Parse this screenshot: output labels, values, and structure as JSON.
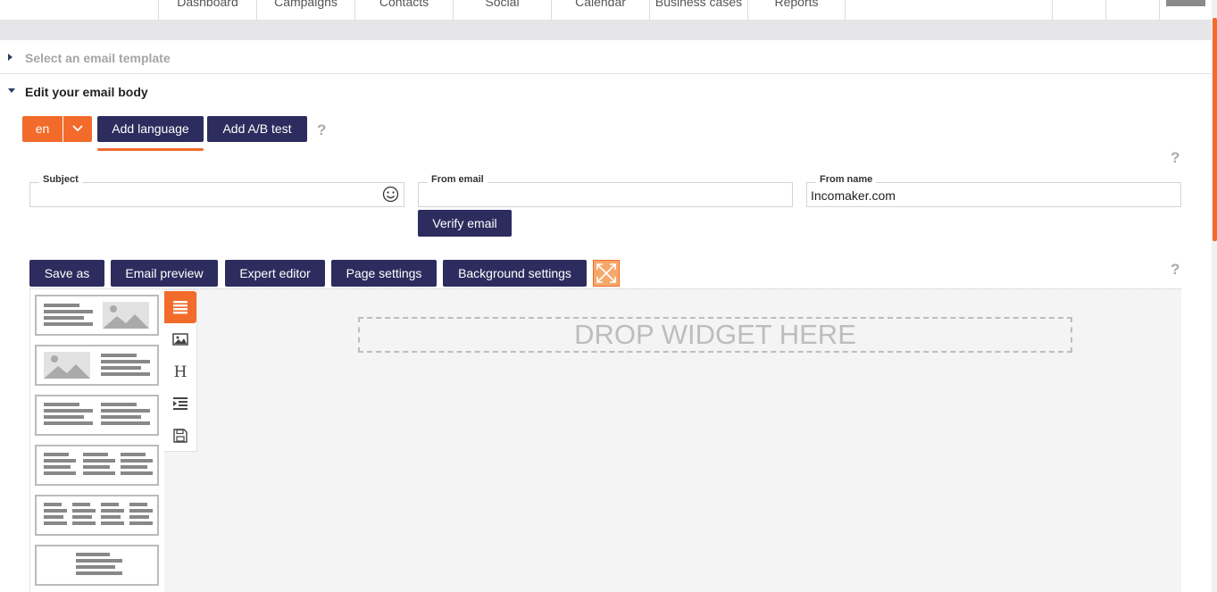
{
  "nav": {
    "tabs": [
      "Dashboard",
      "Campaigns",
      "Contacts",
      "Social",
      "Calendar",
      "Business cases",
      "Reports"
    ]
  },
  "sections": {
    "template_label": "Select an email template",
    "body_label": "Edit your email body"
  },
  "language": {
    "selected": "en",
    "add_language_label": "Add language",
    "add_ab_label": "Add A/B test",
    "help": "?"
  },
  "form": {
    "subject_label": "Subject",
    "subject_value": "",
    "from_email_label": "From email",
    "from_email_value": "",
    "from_name_label": "From name",
    "from_name_value": "Incomaker.com",
    "verify_label": "Verify email",
    "help": "?"
  },
  "toolbar": {
    "save_as": "Save as",
    "email_preview": "Email preview",
    "expert_editor": "Expert editor",
    "page_settings": "Page settings",
    "background_settings": "Background settings",
    "help": "?"
  },
  "canvas": {
    "drop_text": "DROP WIDGET HERE"
  },
  "colors": {
    "accent": "#f26b2b",
    "button": "#2c2c5e"
  }
}
